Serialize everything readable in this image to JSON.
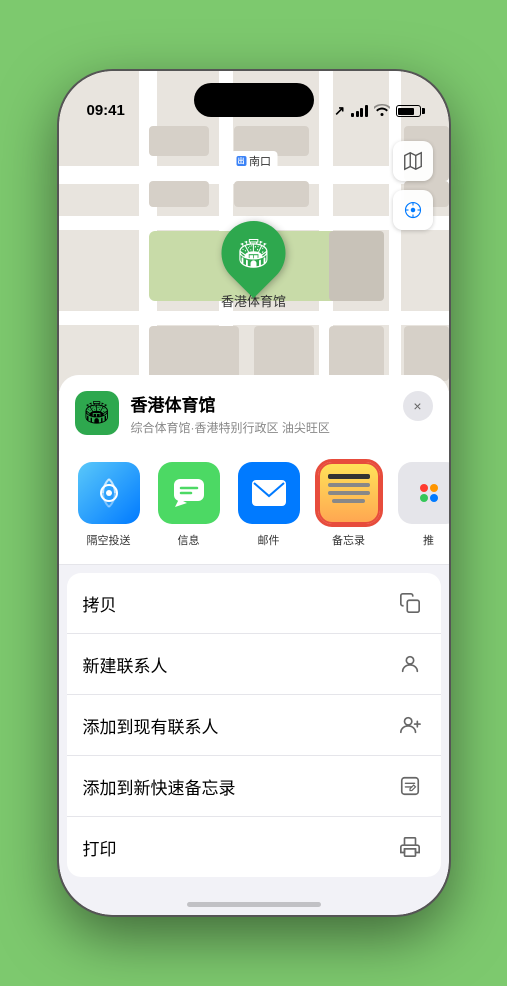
{
  "status_bar": {
    "time": "09:41",
    "location_arrow": "▶"
  },
  "map": {
    "label_text": "南口",
    "pin_label": "香港体育馆",
    "pin_emoji": "🏟"
  },
  "location_header": {
    "name": "香港体育馆",
    "address": "综合体育馆·香港特别行政区 油尖旺区",
    "close_label": "×"
  },
  "share_items": [
    {
      "id": "airdrop",
      "label": "隔空投送",
      "type": "airdrop"
    },
    {
      "id": "message",
      "label": "信息",
      "type": "message"
    },
    {
      "id": "mail",
      "label": "邮件",
      "type": "mail"
    },
    {
      "id": "notes",
      "label": "备忘录",
      "type": "notes",
      "selected": true
    },
    {
      "id": "more",
      "label": "推",
      "type": "more"
    }
  ],
  "action_items": [
    {
      "label": "拷贝",
      "icon": "copy"
    },
    {
      "label": "新建联系人",
      "icon": "person"
    },
    {
      "label": "添加到现有联系人",
      "icon": "person-add"
    },
    {
      "label": "添加到新快速备忘录",
      "icon": "note"
    },
    {
      "label": "打印",
      "icon": "print"
    }
  ]
}
